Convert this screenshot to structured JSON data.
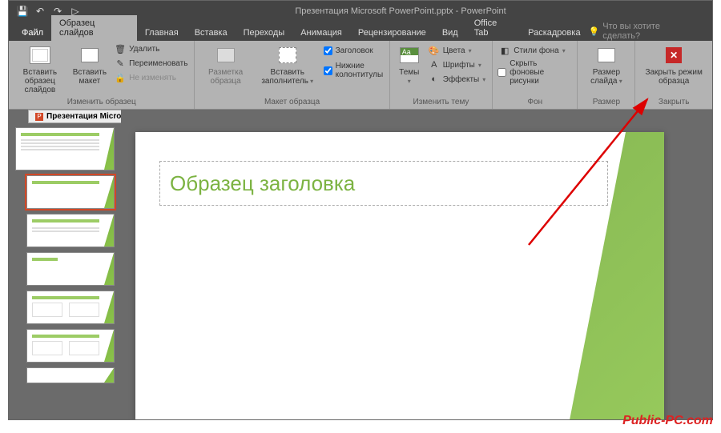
{
  "titlebar": {
    "title": "Презентация Microsoft PowerPoint.pptx - PowerPoint"
  },
  "tabs": {
    "file": "Файл",
    "items": [
      "Образец слайдов",
      "Главная",
      "Вставка",
      "Переходы",
      "Анимация",
      "Рецензирование",
      "Вид",
      "Office Tab",
      "Раскадровка"
    ],
    "active_index": 0,
    "tell_me": "Что вы хотите сделать?"
  },
  "ribbon": {
    "group1": {
      "insert_master": "Вставить образец слайдов",
      "insert_layout": "Вставить макет",
      "delete": "Удалить",
      "rename": "Переименовать",
      "preserve": "Не изменять",
      "label": "Изменить образец"
    },
    "group2": {
      "master_layout": "Разметка образца",
      "insert_ph": "Вставить заполнитель",
      "chk_title": "Заголовок",
      "chk_footers": "Нижние колонтитулы",
      "label": "Макет образца"
    },
    "group3": {
      "themes": "Темы",
      "colors": "Цвета",
      "fonts": "Шрифты",
      "effects": "Эффекты",
      "label": "Изменить тему"
    },
    "group4": {
      "bg_styles": "Стили фона",
      "hide_bg": "Скрыть фоновые рисунки",
      "label": "Фон"
    },
    "group5": {
      "slide_size": "Размер слайда",
      "label": "Размер"
    },
    "group6": {
      "close": "Закрыть режим образца",
      "label": "Закрыть"
    }
  },
  "doc_tab": {
    "name": "Презентация Microsoft PowerPoint.pptx"
  },
  "slide": {
    "title_placeholder": "Образец заголовка"
  },
  "watermark": "Public-PC.com"
}
